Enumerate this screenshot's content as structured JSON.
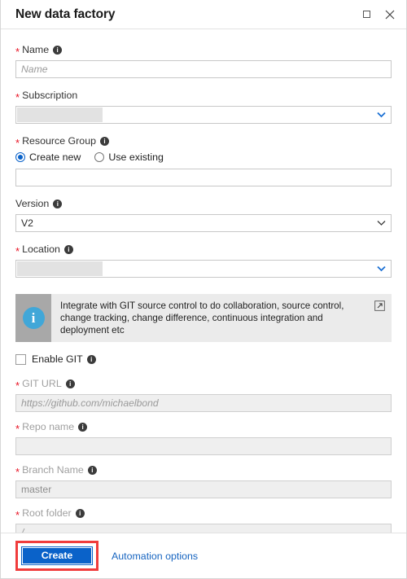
{
  "window": {
    "title": "New data factory",
    "maximize_icon": "maximize-square-icon",
    "close_icon": "close-x-icon"
  },
  "form": {
    "name": {
      "label": "Name",
      "required": true,
      "placeholder": "Name",
      "value": ""
    },
    "subscription": {
      "label": "Subscription",
      "required": true,
      "value": "",
      "redacted": true,
      "chevron_color": "#1a6fd4"
    },
    "resource_group": {
      "label": "Resource Group",
      "required": true,
      "options": [
        {
          "label": "Create new",
          "selected": true
        },
        {
          "label": "Use existing",
          "selected": false
        }
      ],
      "value": "",
      "placeholder": ""
    },
    "version": {
      "label": "Version",
      "required": false,
      "value": "V2",
      "chevron_color": "#3a3a3a"
    },
    "location": {
      "label": "Location",
      "required": true,
      "value": "",
      "redacted": true,
      "chevron_color": "#1a6fd4"
    },
    "banner": {
      "icon": "info-circle-icon",
      "text": "Integrate with GIT source control to do collaboration, source control, change tracking, change difference, continuous integration and deployment etc",
      "link_icon": "external-link-icon"
    },
    "enable_git": {
      "label": "Enable GIT",
      "checked": false
    },
    "git_url": {
      "label": "GIT URL",
      "required": true,
      "placeholder": "https://github.com/michaelbond",
      "value": "",
      "disabled": true
    },
    "repo_name": {
      "label": "Repo name",
      "required": true,
      "placeholder": "",
      "value": "",
      "disabled": true
    },
    "branch_name": {
      "label": "Branch Name",
      "required": true,
      "placeholder": "master",
      "value": "",
      "disabled": true
    },
    "root_folder": {
      "label": "Root folder",
      "required": true,
      "placeholder": "/",
      "value": "",
      "disabled": true
    }
  },
  "footer": {
    "create_label": "Create",
    "automation_label": "Automation options",
    "create_accent": "#0a62c9",
    "highlight_color": "#f03c3c"
  }
}
